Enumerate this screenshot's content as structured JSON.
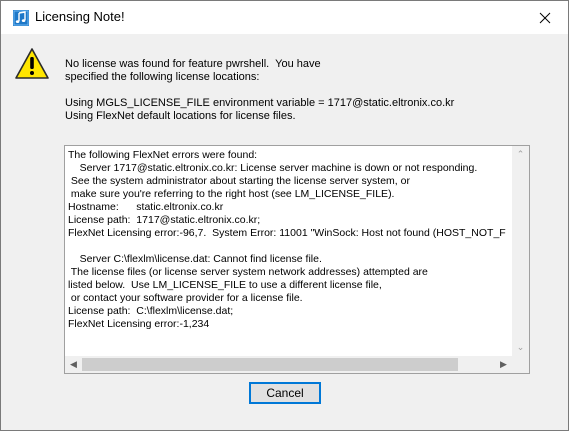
{
  "window": {
    "title": "Licensing Note!",
    "app_icon": "music-note-app-icon",
    "close_icon": "close-icon"
  },
  "message": {
    "icon": "warning-icon",
    "lines": [
      "No license was found for feature pwrshell.  You have",
      "specified the following license locations:",
      "",
      "Using MGLS_LICENSE_FILE environment variable = 1717@static.eltronix.co.kr",
      "Using FlexNet default locations for license files."
    ]
  },
  "errors": {
    "lines": [
      "The following FlexNet errors were found:",
      "    Server 1717@static.eltronix.co.kr: License server machine is down or not responding.",
      " See the system administrator about starting the license server system, or",
      " make sure you're referring to the right host (see LM_LICENSE_FILE).",
      "Hostname:      static.eltronix.co.kr",
      "License path:  1717@static.eltronix.co.kr;",
      "FlexNet Licensing error:-96,7.  System Error: 11001 \"WinSock: Host not found (HOST_NOT_F",
      "",
      "    Server C:\\flexlm\\license.dat: Cannot find license file.",
      " The license files (or license server system network addresses) attempted are",
      "listed below.  Use LM_LICENSE_FILE to use a different license file,",
      " or contact your software provider for a license file.",
      "License path:  C:\\flexlm\\license.dat;",
      "FlexNet Licensing error:-1,234"
    ]
  },
  "buttons": {
    "cancel_label": "Cancel"
  },
  "colors": {
    "accent": "#0078d7",
    "warning_yellow": "#ffe600"
  }
}
